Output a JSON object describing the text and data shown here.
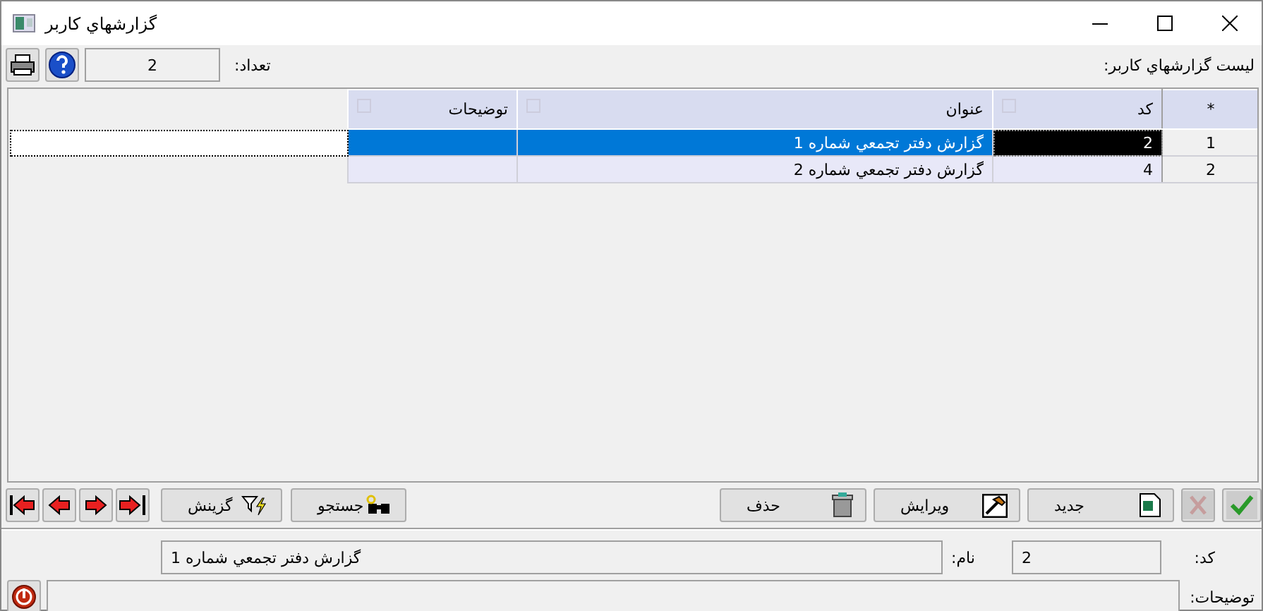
{
  "window": {
    "title": "گزارشهاي کاربر"
  },
  "toolbar": {
    "list_label": "لیست گزارشهاي کاربر:",
    "count_label": "تعداد:",
    "count_value": "2"
  },
  "table": {
    "corner": "*",
    "columns": [
      {
        "label": "کد"
      },
      {
        "label": "عنوان"
      },
      {
        "label": "توضیحات"
      }
    ],
    "rows": [
      {
        "number": "1",
        "cells": [
          "2",
          "گزارش دفتر تجمعي شماره 1",
          ""
        ],
        "selected": true
      },
      {
        "number": "2",
        "cells": [
          "4",
          "گزارش دفتر تجمعي شماره 2",
          ""
        ],
        "selected": false
      }
    ]
  },
  "actions": [
    {
      "kind": "ok",
      "disabled": false
    },
    {
      "kind": "cancel",
      "disabled": true
    },
    {
      "kind": "new",
      "label": "جدید"
    },
    {
      "kind": "edit",
      "label": "ویرایش"
    },
    {
      "kind": "delete",
      "label": "حذف"
    },
    {
      "kind": "search",
      "label": "جستجو"
    },
    {
      "kind": "filter",
      "label": "گزینش"
    }
  ],
  "nav_buttons": [
    {
      "kind": "last"
    },
    {
      "kind": "next"
    },
    {
      "kind": "prev"
    },
    {
      "kind": "first"
    }
  ],
  "details": {
    "code_label": "کد:",
    "code_value": "2",
    "name_label": "نام:",
    "name_value": "گزارش دفتر تجمعي شماره 1",
    "description_label": "توضیحات:"
  }
}
